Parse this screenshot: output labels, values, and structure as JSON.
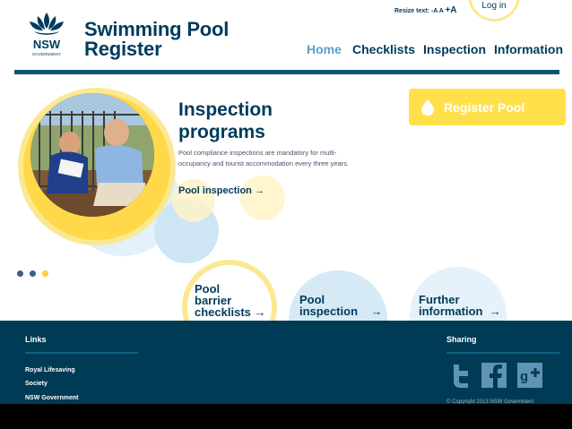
{
  "header": {
    "logo_text": "NSW",
    "logo_subtext": "GOVERNMENT",
    "title_line1": "Swimming Pool",
    "title_line2": "Register",
    "resize_label": "Resize text:",
    "resize_small": "-A",
    "resize_normal": "A",
    "resize_large": "+A",
    "login": "Log in",
    "nav": [
      "Home",
      "Checklists",
      "Inspection",
      "Information"
    ],
    "active_nav": "Home"
  },
  "hero": {
    "title_line1": "Inspection",
    "title_line2": "programs",
    "body": "Pool compliance inspections are mandatory for multi-occupancy and tourist accommodation every three years.",
    "link": "Pool inspection →",
    "register_button": "Register Pool",
    "register_icon": "drop-icon",
    "slide_count": 3,
    "active_slide": 3
  },
  "quick_links": [
    {
      "line1": "Pool",
      "line2": "barrier",
      "line3": "checklists →"
    },
    {
      "line1": "Pool",
      "line2": "inspection    →"
    },
    {
      "line1": "Further",
      "line2": "information  →"
    }
  ],
  "footer": {
    "links_heading": "Links",
    "links": [
      "Royal Lifesaving",
      "Society",
      "NSW Government"
    ],
    "sharing_heading": "Sharing",
    "social": [
      "twitter-icon",
      "facebook-icon",
      "google-plus-icon"
    ],
    "copyright": "© Copyright 2013 NSW Government"
  },
  "colors": {
    "navy": "#003b5c",
    "accent_blue": "#5b9ec6",
    "yellow": "#ffe04a",
    "footer_bg": "#003b56"
  }
}
